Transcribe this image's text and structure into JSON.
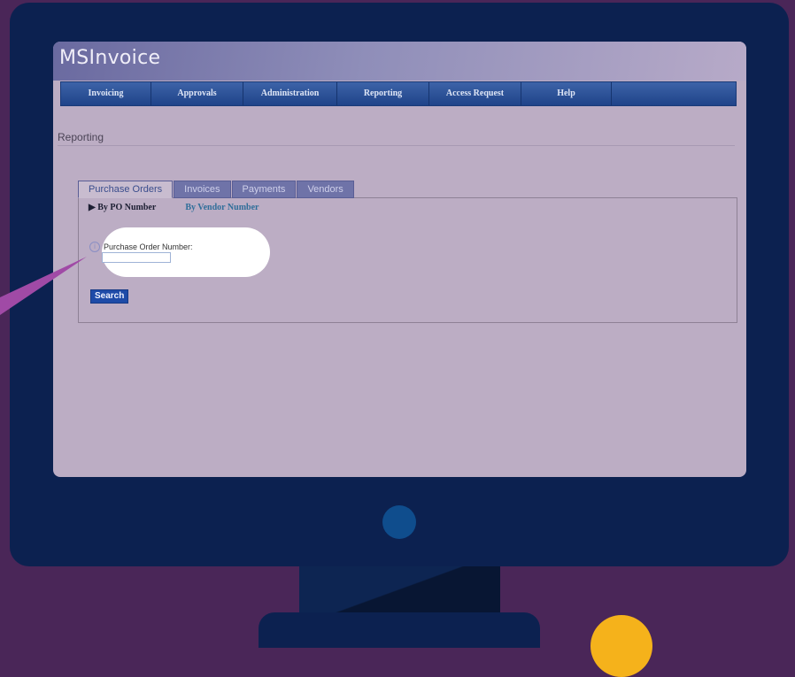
{
  "app": {
    "title": "MSInvoice"
  },
  "nav": {
    "items": [
      {
        "label": "Invoicing"
      },
      {
        "label": "Approvals"
      },
      {
        "label": "Administration"
      },
      {
        "label": "Reporting"
      },
      {
        "label": "Access Request"
      },
      {
        "label": "Help"
      }
    ]
  },
  "page": {
    "heading": "Reporting"
  },
  "tabs": [
    {
      "label": "Purchase Orders",
      "active": true
    },
    {
      "label": "Invoices",
      "active": false
    },
    {
      "label": "Payments",
      "active": false
    },
    {
      "label": "Vendors",
      "active": false
    }
  ],
  "subnav": {
    "current": "By PO Number",
    "link": "By Vendor Number"
  },
  "form": {
    "field_label": "Purchase Order Number:",
    "field_value": "",
    "search_label": "Search"
  },
  "colors": {
    "background": "#4a2658",
    "monitor": "#0c2150",
    "screen": "#bcadc4",
    "accent": "#1e4ba8",
    "highlight": "#ffffff",
    "callout_pointer": "#a04aa6",
    "yellow_dot": "#f5b21b"
  }
}
